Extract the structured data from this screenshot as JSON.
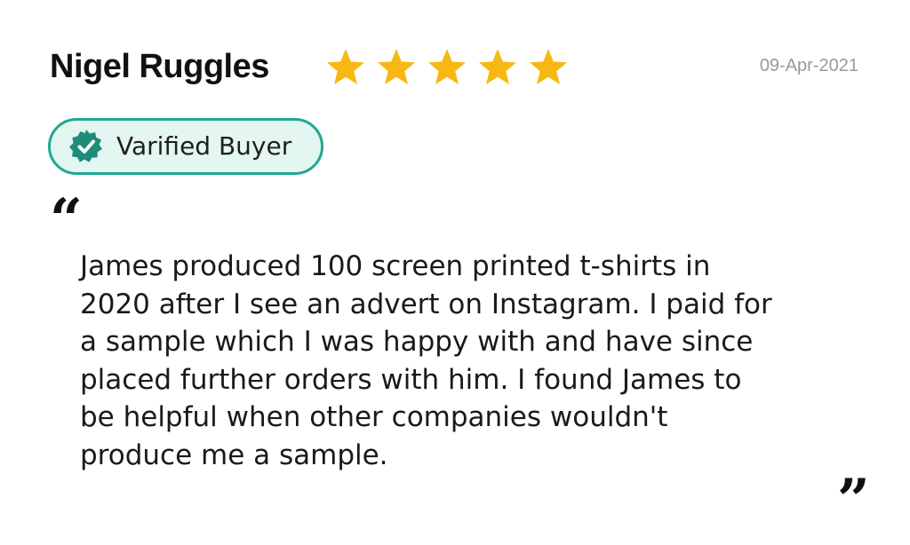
{
  "review": {
    "reviewer_name": "Nigel Ruggles",
    "rating": 5,
    "rating_max": 5,
    "date": "09-Apr-2021",
    "badge": {
      "label": "Varified Buyer",
      "icon": "verified-check-icon"
    },
    "quote_open_glyph": "“",
    "quote_close_glyph": "”",
    "body_lines": [
      "James produced 100 screen printed t-shirts in",
      "2020 after I see an advert on Instagram. I paid for",
      "a sample which I was happy with and have since",
      "placed further orders with him. I found James to",
      "be helpful when other companies wouldn't",
      "produce me a sample."
    ]
  },
  "colors": {
    "star": "#f7b813",
    "badge_border": "#1fa992",
    "badge_background": "#e3f6f2",
    "badge_icon": "#1e8c78",
    "date": "#9a9a9a",
    "text": "#1a1a1a"
  }
}
